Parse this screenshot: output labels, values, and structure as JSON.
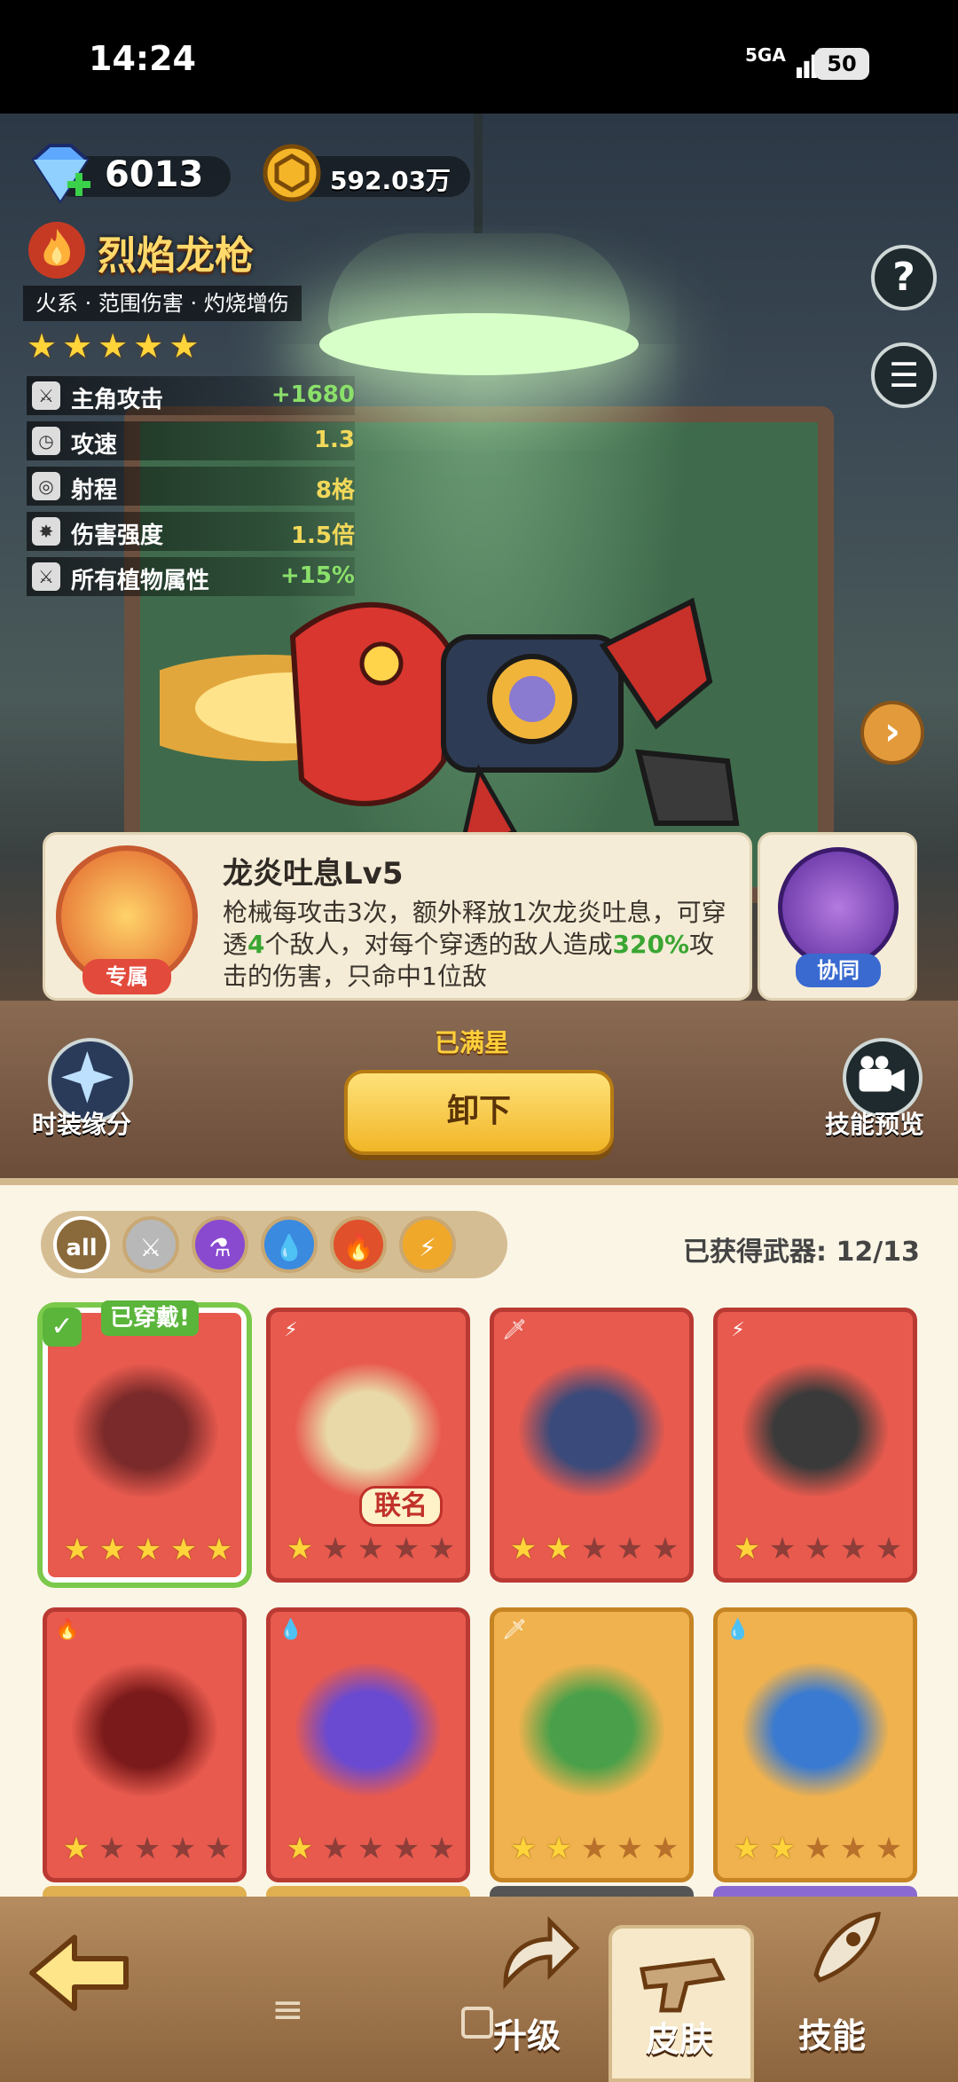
{
  "status_bar": {
    "time": "14:24",
    "network": "5GA",
    "battery": "50"
  },
  "currency": {
    "gems": "6013",
    "coins": "592.03万"
  },
  "weapon": {
    "name": "烈焰龙枪",
    "tags": "火系 · 范围伤害 · 灼烧增伤",
    "stars": 5,
    "stats": [
      {
        "label": "主角攻击",
        "value": "+1680",
        "value_color": "#8be06a",
        "icon": "sword-icon"
      },
      {
        "label": "攻速",
        "value": "1.3",
        "value_color": "#f2d85a",
        "icon": "clock-icon"
      },
      {
        "label": "射程",
        "value": "8格",
        "value_color": "#f2d85a",
        "icon": "target-icon"
      },
      {
        "label": "伤害强度",
        "value": "1.5倍",
        "value_color": "#f2d85a",
        "icon": "burst-icon"
      },
      {
        "label": "所有植物属性",
        "value": "+15%",
        "value_color": "#8be06a",
        "icon": "sword-icon"
      }
    ]
  },
  "skill": {
    "title": "龙炎吐息Lv5",
    "badge": "专属",
    "desc_parts": [
      "枪械每攻击3次，额外释放1次龙炎吐息，可穿透",
      "4",
      "个敌人，对每个穿透的敌人造成",
      "320%",
      "攻击的伤害，只命中1位敌"
    ],
    "highlight_color": "#3aa632",
    "synergy_label": "协同"
  },
  "actions": {
    "max_star": "已满星",
    "unequip": "卸下",
    "costume": "时装缘分",
    "preview": "技能预览"
  },
  "collection": {
    "filters": [
      "all",
      "blade",
      "potion",
      "water",
      "fire",
      "lightning"
    ],
    "owned": "已获得武器: 12/13",
    "equipped_tag": "已穿戴!",
    "co_brand_tag": "联名",
    "cards": [
      {
        "theme": "red",
        "element": "fire",
        "stars": 5,
        "equipped": true,
        "co_brand": false
      },
      {
        "theme": "red",
        "element": "lightning",
        "stars": 1,
        "equipped": false,
        "co_brand": true
      },
      {
        "theme": "red",
        "element": "blade",
        "stars": 2,
        "equipped": false,
        "co_brand": false
      },
      {
        "theme": "red",
        "element": "lightning",
        "stars": 1,
        "equipped": false,
        "co_brand": false
      },
      {
        "theme": "red",
        "element": "fire",
        "stars": 1,
        "equipped": false,
        "co_brand": false
      },
      {
        "theme": "red",
        "element": "water",
        "stars": 1,
        "equipped": false,
        "co_brand": false
      },
      {
        "theme": "gold",
        "element": "blade",
        "stars": 2,
        "equipped": false,
        "co_brand": false
      },
      {
        "theme": "gold",
        "element": "water",
        "stars": 2,
        "equipped": false,
        "co_brand": false
      }
    ]
  },
  "nav": {
    "upgrade": "升级",
    "skin": "皮肤",
    "skill": "技能"
  }
}
